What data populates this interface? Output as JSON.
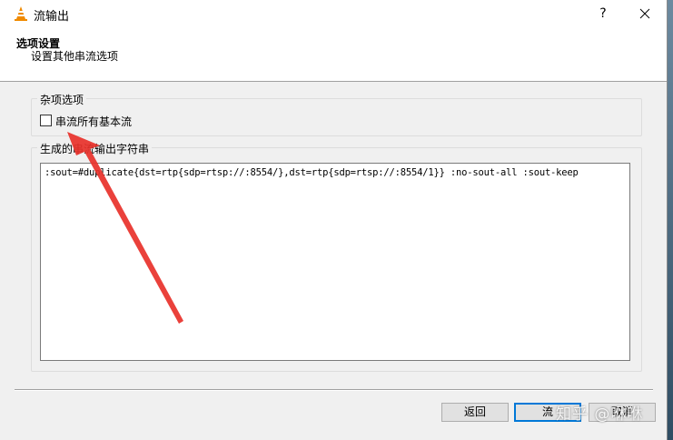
{
  "window": {
    "title": "流输出",
    "help_label": "?"
  },
  "header": {
    "title": "选项设置",
    "subtitle": "设置其他串流选项"
  },
  "misc_group": {
    "title": "杂项选项",
    "checkbox_label": "串流所有基本流",
    "checked": false
  },
  "output_group": {
    "title": "生成的串流输出字符串",
    "value": ":sout=#duplicate{dst=rtp{sdp=rtsp://:8554/},dst=rtp{sdp=rtsp://:8554/1}} :no-sout-all :sout-keep"
  },
  "buttons": {
    "back": "返回",
    "stream": "流",
    "cancel": "取消"
  },
  "watermark": "知乎 @咻咻",
  "colors": {
    "arrow": "#e8312a",
    "accent": "#0078d7"
  }
}
